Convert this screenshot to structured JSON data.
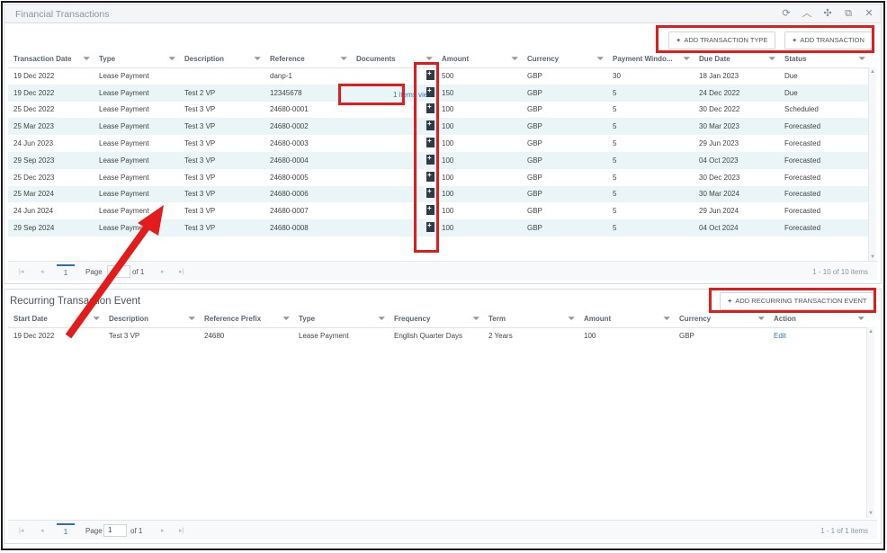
{
  "panel_title": "Financial Transactions",
  "window_icons": [
    "refresh-icon",
    "collapse-icon",
    "compress-icon",
    "popout-icon",
    "close-icon"
  ],
  "toolbar": {
    "add_type_label": "ADD TRANSACTION TYPE",
    "add_transaction_label": "ADD TRANSACTION"
  },
  "transactions": {
    "columns": [
      "Transaction Date",
      "Type",
      "Description",
      "Reference",
      "Documents",
      "Amount",
      "Currency",
      "Payment Windo...",
      "Due Date",
      "Status"
    ],
    "rows": [
      [
        "19 Dec 2022",
        "Lease Payment",
        "",
        "danp-1",
        "",
        "500",
        "GBP",
        "30",
        "18 Jan 2023",
        "Due"
      ],
      [
        "19 Dec 2022",
        "Lease Payment",
        "Test 2 VP",
        "12345678",
        "1 items view",
        "150",
        "GBP",
        "5",
        "24 Dec 2022",
        "Due"
      ],
      [
        "25 Dec 2022",
        "Lease Payment",
        "Test 3 VP",
        "24680-0001",
        "",
        "100",
        "GBP",
        "5",
        "30 Dec 2022",
        "Scheduled"
      ],
      [
        "25 Mar 2023",
        "Lease Payment",
        "Test 3 VP",
        "24680-0002",
        "",
        "100",
        "GBP",
        "5",
        "30 Mar 2023",
        "Forecasted"
      ],
      [
        "24 Jun 2023",
        "Lease Payment",
        "Test 3 VP",
        "24680-0003",
        "",
        "100",
        "GBP",
        "5",
        "29 Jun 2023",
        "Forecasted"
      ],
      [
        "29 Sep 2023",
        "Lease Payment",
        "Test 3 VP",
        "24680-0004",
        "",
        "100",
        "GBP",
        "5",
        "04 Oct 2023",
        "Forecasted"
      ],
      [
        "25 Dec 2023",
        "Lease Payment",
        "Test 3 VP",
        "24680-0005",
        "",
        "100",
        "GBP",
        "5",
        "30 Dec 2023",
        "Forecasted"
      ],
      [
        "25 Mar 2024",
        "Lease Payment",
        "Test 3 VP",
        "24680-0006",
        "",
        "100",
        "GBP",
        "5",
        "30 Mar 2024",
        "Forecasted"
      ],
      [
        "24 Jun 2024",
        "Lease Payment",
        "Test 3 VP",
        "24680-0007",
        "",
        "100",
        "GBP",
        "5",
        "29 Jun 2024",
        "Forecasted"
      ],
      [
        "29 Sep 2024",
        "Lease Payment",
        "Test 3 VP",
        "24680-0008",
        "",
        "100",
        "GBP",
        "5",
        "04 Oct 2024",
        "Forecasted"
      ]
    ],
    "pager": {
      "current": "1",
      "page_label": "Page",
      "page_value": "1",
      "of_label": "of 1",
      "info": "1 - 10 of 10 items"
    }
  },
  "recurring": {
    "title": "Recurring Transaction Event",
    "add_label": "ADD RECURRING TRANSACTION EVENT",
    "columns": [
      "Start Date",
      "Description",
      "Reference Prefix",
      "Type",
      "Frequency",
      "Term",
      "Amount",
      "Currency",
      "Action"
    ],
    "rows": [
      [
        "19 Dec 2022",
        "Test 3 VP",
        "24680",
        "Lease Payment",
        "English Quarter Days",
        "2 Years",
        "100",
        "GBP",
        "Edit"
      ]
    ],
    "pager": {
      "current": "1",
      "page_label": "Page",
      "page_value": "1",
      "of_label": "of 1",
      "info": "1 - 1 of 1 items"
    }
  },
  "colors": {
    "highlight_red": "#e31b1b",
    "row_alt": "#eaf5f7",
    "link_blue": "#2b7bbf"
  }
}
